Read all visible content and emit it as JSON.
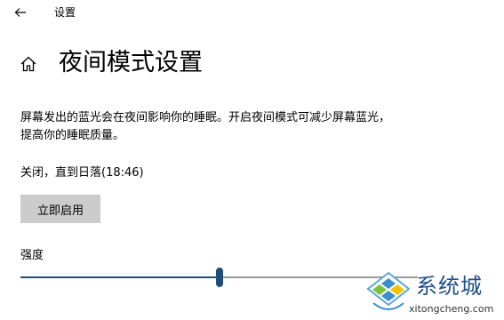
{
  "window": {
    "title": "设置"
  },
  "page": {
    "title": "夜间模式设置",
    "description_line1": "屏幕发出的蓝光会在夜间影响你的睡眠。开启夜间模式可减少屏幕蓝光，",
    "description_line2": "提高你的睡眠质量。",
    "status": "关闭，直到日落(18:46)",
    "enable_button_label": "立即启用",
    "strength_label": "强度",
    "strength_value": 0.5
  },
  "icons": {
    "back": "back-arrow-icon",
    "home": "home-icon"
  },
  "colors": {
    "accent": "#1f4e79",
    "button_bg": "#cccccc",
    "track": "#999999"
  },
  "watermark": {
    "name": "系统城",
    "domain": "xitongcheng.com"
  }
}
